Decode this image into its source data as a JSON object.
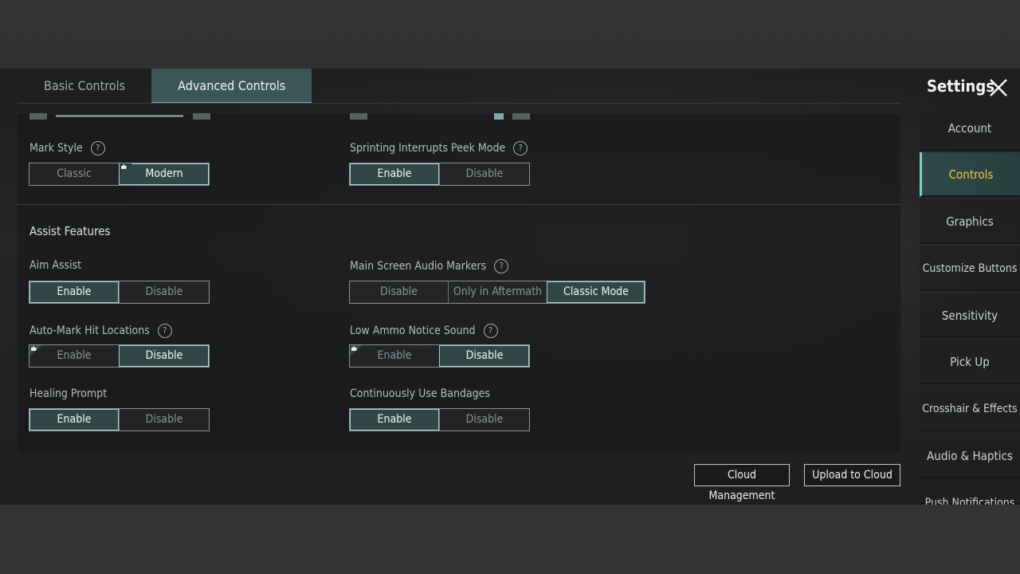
{
  "header": {
    "title": "Settings"
  },
  "tabs": [
    {
      "label": "Basic Controls",
      "active": false
    },
    {
      "label": "Advanced Controls",
      "active": true
    }
  ],
  "sidenav": [
    {
      "label": "Account",
      "active": false
    },
    {
      "label": "Controls",
      "active": true
    },
    {
      "label": "Graphics",
      "active": false
    },
    {
      "label": "Customize Buttons",
      "active": false
    },
    {
      "label": "Sensitivity",
      "active": false
    },
    {
      "label": "Pick Up",
      "active": false
    },
    {
      "label": "Crosshair & Effects",
      "active": false
    },
    {
      "label": "Audio & Haptics",
      "active": false
    },
    {
      "label": "Push Notifications",
      "active": false
    }
  ],
  "settings": {
    "mark_style": {
      "label": "Mark Style",
      "options": [
        "Classic",
        "Modern"
      ],
      "selected": "Modern"
    },
    "sprinting_peek": {
      "label": "Sprinting Interrupts Peek Mode",
      "options": [
        "Enable",
        "Disable"
      ],
      "selected": "Enable"
    },
    "assist_title": "Assist Features",
    "aim_assist": {
      "label": "Aim Assist",
      "options": [
        "Enable",
        "Disable"
      ],
      "selected": "Enable"
    },
    "audio_markers": {
      "label": "Main Screen Audio Markers",
      "options": [
        "Disable",
        "Only in Aftermath",
        "Classic Mode"
      ],
      "selected": "Classic Mode"
    },
    "auto_mark": {
      "label": "Auto-Mark Hit Locations",
      "options": [
        "Enable",
        "Disable"
      ],
      "selected": "Disable"
    },
    "low_ammo": {
      "label": "Low Ammo Notice Sound",
      "options": [
        "Enable",
        "Disable"
      ],
      "selected": "Disable"
    },
    "healing": {
      "label": "Healing Prompt",
      "options": [
        "Enable",
        "Disable"
      ],
      "selected": "Enable"
    },
    "bandages": {
      "label": "Continuously Use Bandages",
      "options": [
        "Enable",
        "Disable"
      ],
      "selected": "Enable"
    }
  },
  "buttons": {
    "cloud_management": "Cloud Management",
    "upload_to_cloud": "Upload to Cloud"
  },
  "help_glyph": "?",
  "colors": {
    "accent": "#7fb3ae",
    "selected_bg": "#314747",
    "active_nav_text": "#f3c548"
  }
}
